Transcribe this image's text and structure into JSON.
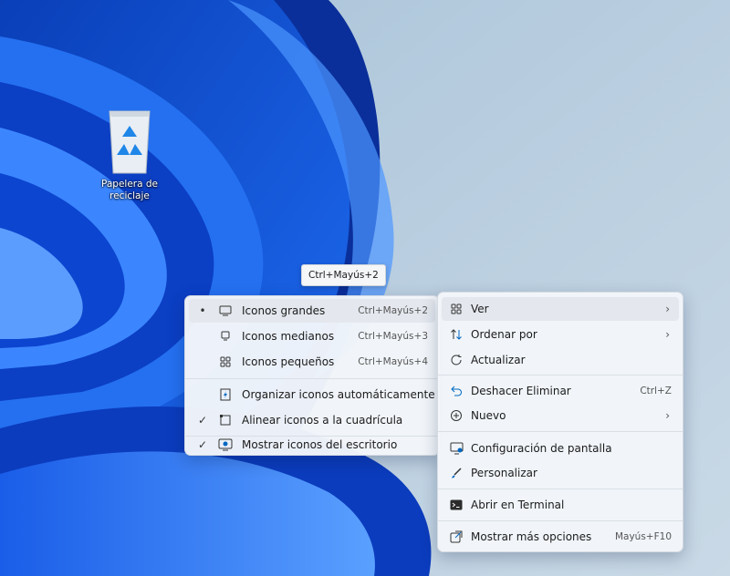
{
  "desktop": {
    "recycle_bin_label": "Papelera de reciclaje"
  },
  "tooltip": "Ctrl+Mayús+2",
  "view_submenu": {
    "items": [
      {
        "label": "Iconos grandes",
        "shortcut": "Ctrl+Mayús+2",
        "selected": true
      },
      {
        "label": "Iconos medianos",
        "shortcut": "Ctrl+Mayús+3"
      },
      {
        "label": "Iconos pequeños",
        "shortcut": "Ctrl+Mayús+4"
      },
      {
        "label": "Organizar iconos automáticamente"
      },
      {
        "label": "Alinear iconos a la cuadrícula",
        "checked": true
      },
      {
        "label": "Mostrar iconos del escritorio",
        "checked": true
      }
    ],
    "bullet": "•",
    "checkmark": "✓"
  },
  "context_menu": {
    "items": [
      {
        "label": "Ver",
        "icon": "grid-icon",
        "has_submenu": true
      },
      {
        "label": "Ordenar por",
        "icon": "sort-icon",
        "has_submenu": true
      },
      {
        "label": "Actualizar",
        "icon": "refresh-icon"
      },
      {
        "label": "Deshacer Eliminar",
        "icon": "undo-icon",
        "shortcut": "Ctrl+Z"
      },
      {
        "label": "Nuevo",
        "icon": "plus-circle-icon",
        "has_submenu": true
      },
      {
        "label": "Configuración de pantalla",
        "icon": "display-settings-icon"
      },
      {
        "label": "Personalizar",
        "icon": "brush-icon"
      },
      {
        "label": "Abrir en Terminal",
        "icon": "terminal-icon"
      },
      {
        "label": "Mostrar más opciones",
        "icon": "more-options-icon",
        "shortcut": "Mayús+F10"
      }
    ],
    "arrow": "›"
  },
  "colors": {
    "accent": "#0067c0",
    "menu_bg": "#f3f6fa",
    "hover": "#e4e8ee"
  }
}
